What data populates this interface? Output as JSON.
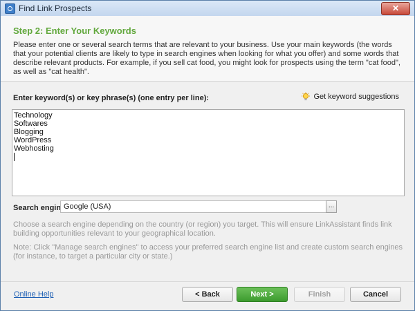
{
  "window": {
    "title": "Find Link Prospects",
    "close_label": "✕"
  },
  "header": {
    "step_title": "Step 2: Enter Your Keywords",
    "intro": "Please enter one or several search terms that are relevant to your business. Use your main keywords (the words that your potential clients are likely to type in search engines when looking for what you offer) and some words that describe relevant products. For example, if you sell cat food, you might look for prospects using the term \"cat food\", as well as \"cat health\"."
  },
  "keywords": {
    "label": "Enter keyword(s) or key phrase(s) (one entry per line):",
    "suggest_label": "Get keyword suggestions",
    "entries": [
      "Technology",
      "Softwares",
      "Blogging",
      "WordPress",
      "Webhosting"
    ]
  },
  "search_engine": {
    "label": "Search engine",
    "value": "Google (USA)",
    "browse_label": "...",
    "hint": "Choose a search engine depending on the country (or region) you target. This will ensure LinkAssistant finds link building opportunities relevant to your geographical location.",
    "note": "Note: Click \"Manage search engines\" to access your preferred search engine list and create custom search engines (for instance, to target a particular city or state.)"
  },
  "footer": {
    "online_help": "Online Help",
    "back": "< Back",
    "next": "Next >",
    "finish": "Finish",
    "cancel": "Cancel"
  },
  "colors": {
    "accent_green": "#62a83d",
    "link_blue": "#1d5fb4",
    "close_red": "#c8493a"
  }
}
